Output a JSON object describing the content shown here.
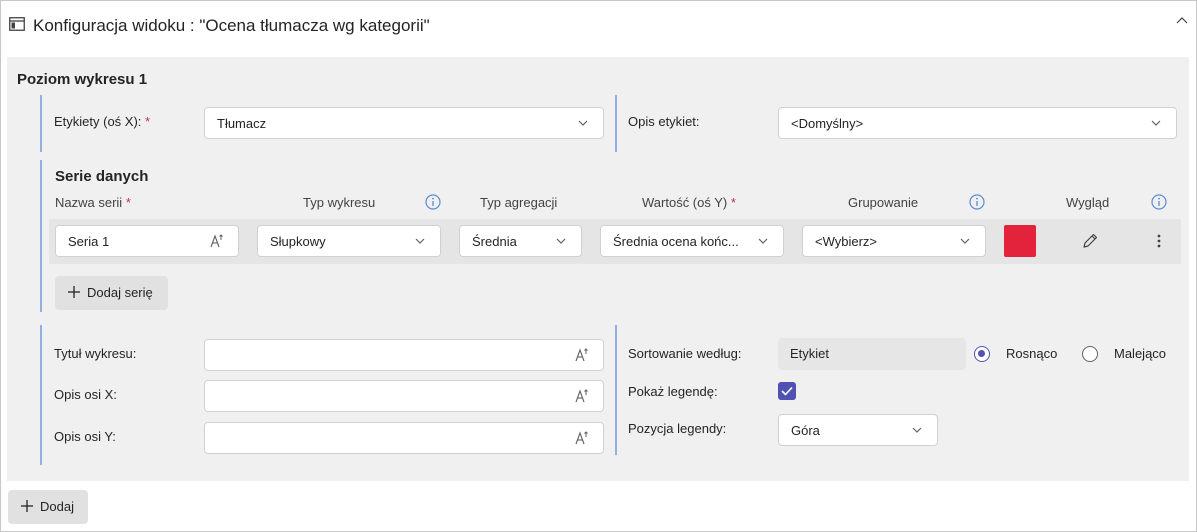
{
  "header": {
    "title": "Konfiguracja widoku : \"Ocena tłumacza wg kategorii\""
  },
  "section": {
    "title": "Poziom wykresu 1"
  },
  "labels_field": {
    "label": "Etykiety (oś X):",
    "required_mark": "*",
    "value": "Tłumacz"
  },
  "labels_description": {
    "label": "Opis etykiet:",
    "value": "<Domyślny>"
  },
  "series": {
    "title": "Serie danych",
    "columns": {
      "name": "Nazwa serii",
      "name_required": "*",
      "chart_type": "Typ wykresu",
      "aggregation": "Typ agregacji",
      "value": "Wartość (oś Y)",
      "value_required": "*",
      "grouping": "Grupowanie",
      "appearance": "Wygląd"
    },
    "rows": [
      {
        "name": "Seria 1",
        "chart_type": "Słupkowy",
        "aggregation": "Średnia",
        "value": "Średnia ocena końc...",
        "grouping": "<Wybierz>",
        "color": "#e3223c"
      }
    ],
    "add_button": "Dodaj serię"
  },
  "chart_options": {
    "title_label": "Tytuł wykresu:",
    "title_value": "",
    "x_axis_label": "Opis osi X:",
    "x_axis_value": "",
    "y_axis_label": "Opis osi Y:",
    "y_axis_value": ""
  },
  "sorting": {
    "label": "Sortowanie według:",
    "value": "Etykiet",
    "options": [
      "Rosnąco",
      "Malejąco"
    ],
    "selected": "Rosnąco"
  },
  "legend": {
    "show_label": "Pokaż legendę:",
    "show_checked": true,
    "position_label": "Pozycja legendy:",
    "position_value": "Góra"
  },
  "footer": {
    "add_button": "Dodaj"
  },
  "colors": {
    "accent": "#4f52b2",
    "required": "#c4314b",
    "bar_accent": "#8fb0e0",
    "series_color": "#e3223c"
  }
}
